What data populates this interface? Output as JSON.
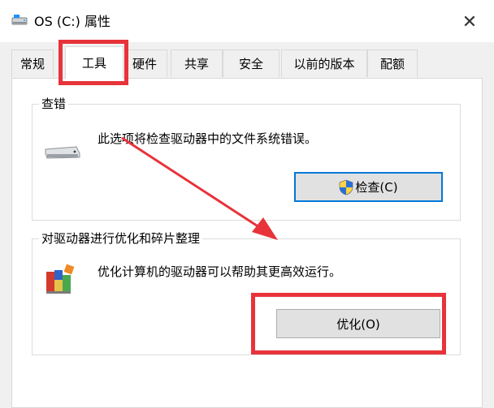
{
  "window": {
    "title": "OS (C:) 属性",
    "close_label": "✕"
  },
  "tabs": [
    {
      "label": "常规"
    },
    {
      "label": "工具"
    },
    {
      "label": "硬件"
    },
    {
      "label": "共享"
    },
    {
      "label": "安全"
    },
    {
      "label": "以前的版本"
    },
    {
      "label": "配额"
    }
  ],
  "active_tab": "工具",
  "error_checking": {
    "title": "查错",
    "description": "此选项将检查驱动器中的文件系统错误。",
    "button_label": "检查(C)",
    "icon": "drive-icon",
    "button_icon": "uac-shield-icon"
  },
  "optimize": {
    "title": "对驱动器进行优化和碎片整理",
    "description": "优化计算机的驱动器可以帮助其更高效运行。",
    "button_label": "优化(O)",
    "icon": "defrag-icon"
  },
  "annotations": {
    "highlight_color": "#e8333a"
  }
}
